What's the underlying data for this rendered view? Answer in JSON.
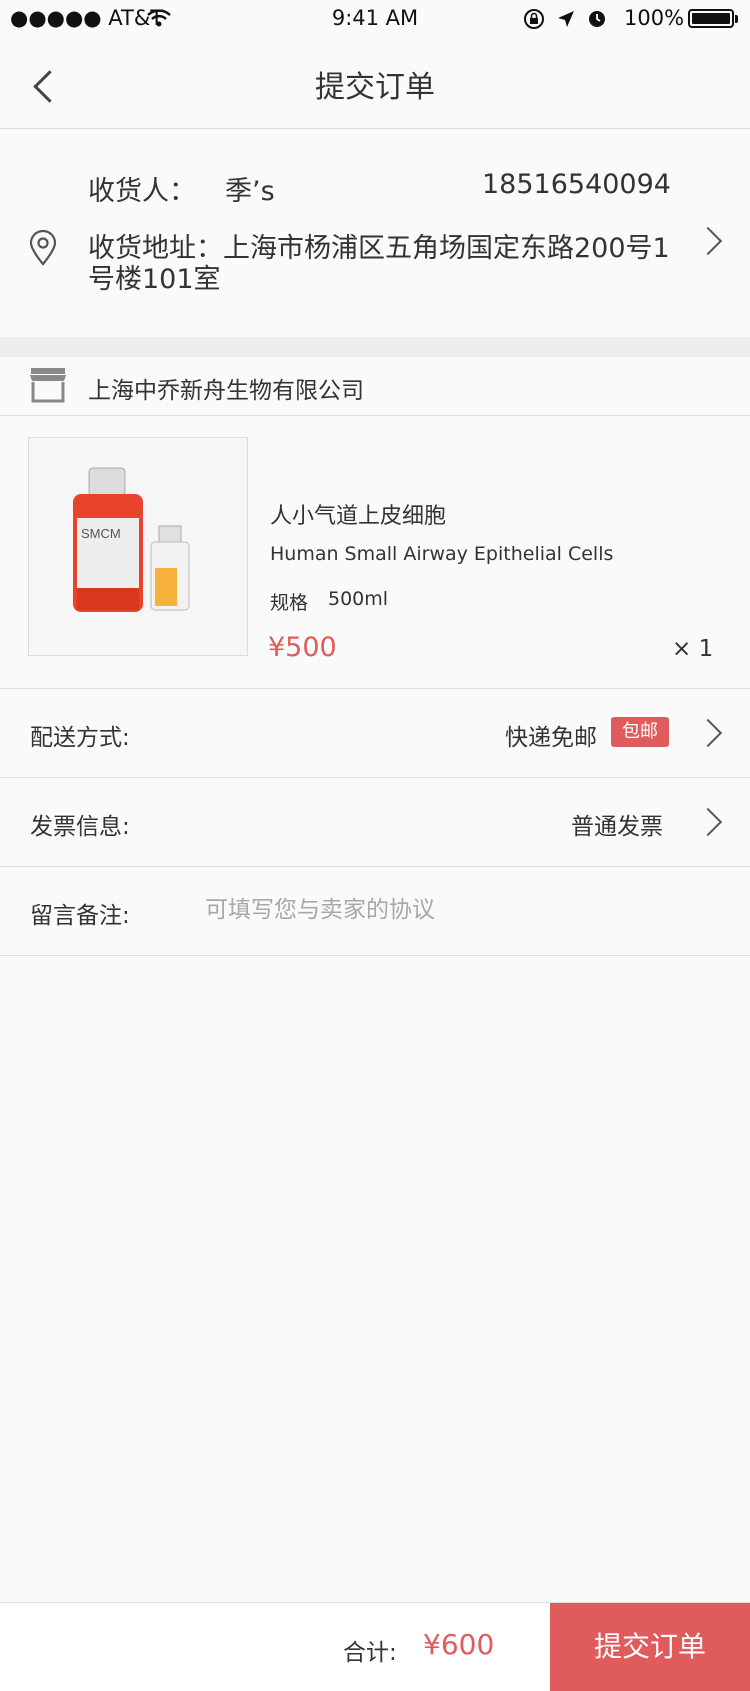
{
  "status_bar": {
    "carrier": "●●●●● AT&T",
    "time": "9:41 AM",
    "battery": "100%"
  },
  "nav": {
    "title": "提交订单",
    "back_icon": "chevron-left-icon"
  },
  "address": {
    "receiver_label": "收货人：",
    "receiver_name": "季’s",
    "phone": "18516540094",
    "address_line1": "收货地址：上海市杨浦区五角场国定东路200号1",
    "address_line2": "号楼101室"
  },
  "store": {
    "name": "上海中乔新舟生物有限公司",
    "icon": "store-icon"
  },
  "product": {
    "name_cn": "人小气道上皮细胞",
    "name_en": "Human Small Airway Epithelial Cells",
    "spec_label": "规格",
    "spec_value": "500ml",
    "price": "¥500",
    "quantity": "× 1",
    "image_label": "SMCM"
  },
  "delivery": {
    "label": "配送方式:",
    "value": "快递免邮",
    "badge": "包邮"
  },
  "invoice": {
    "label": "发票信息:",
    "value": "普通发票"
  },
  "remark": {
    "label": "留言备注:",
    "placeholder": "可填写您与卖家的协议"
  },
  "footer": {
    "total_label": "合计:",
    "total_value": "¥600",
    "submit_label": "提交订单"
  },
  "colors": {
    "accent": "#e05c5c",
    "divider": "#dedede",
    "background": "#fafafa"
  }
}
